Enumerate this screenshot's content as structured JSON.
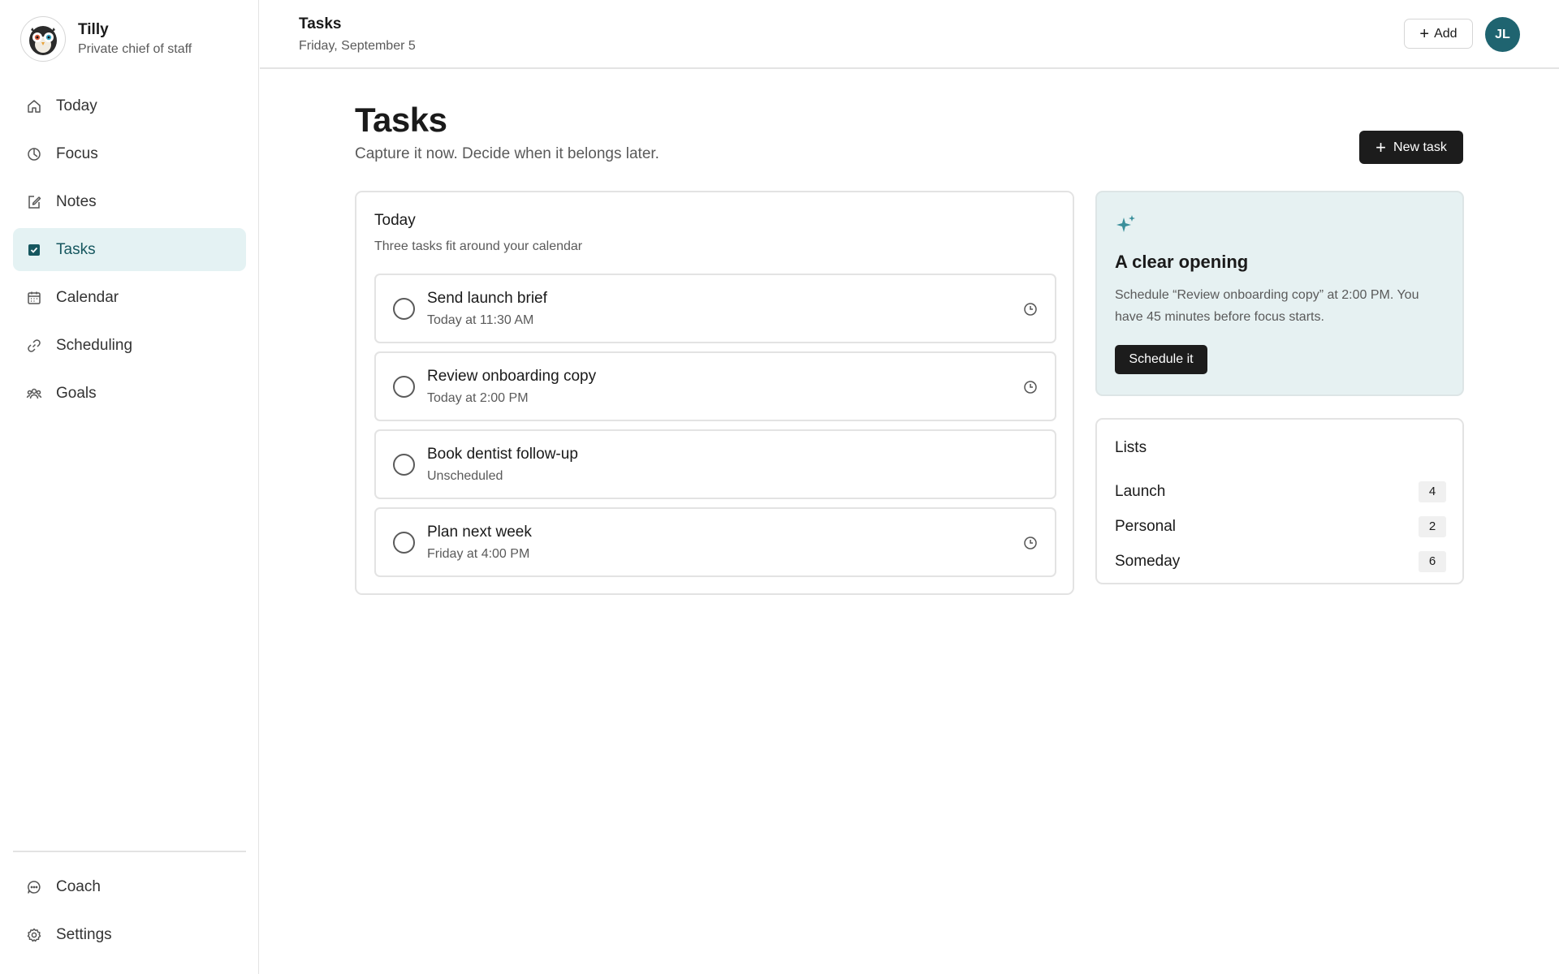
{
  "app": {
    "name": "Tilly",
    "tagline": "Private chief of staff"
  },
  "sidebar": {
    "items": [
      {
        "label": "Today",
        "icon": "home-icon"
      },
      {
        "label": "Focus",
        "icon": "focus-icon"
      },
      {
        "label": "Notes",
        "icon": "note-edit-icon"
      },
      {
        "label": "Tasks",
        "icon": "checkbox-icon",
        "active": true
      },
      {
        "label": "Calendar",
        "icon": "calendar-icon"
      },
      {
        "label": "Scheduling",
        "icon": "link-icon"
      },
      {
        "label": "Goals",
        "icon": "people-icon"
      }
    ],
    "bottom_items": [
      {
        "label": "Coach",
        "icon": "chat-icon"
      },
      {
        "label": "Settings",
        "icon": "gear-icon"
      }
    ]
  },
  "header": {
    "title": "Tasks",
    "date": "Friday, September 5",
    "add_label": "Add",
    "avatar_initials": "JL"
  },
  "main": {
    "title": "Tasks",
    "subtitle": "Capture it now. Decide when it belongs later.",
    "new_task_label": "New task"
  },
  "today_card": {
    "title": "Today",
    "subtitle": "Three tasks fit around your calendar",
    "tasks": [
      {
        "title": "Send launch brief",
        "time": "Today at 11:30 AM",
        "has_clock": true
      },
      {
        "title": "Review onboarding copy",
        "time": "Today at 2:00 PM",
        "has_clock": true
      },
      {
        "title": "Book dentist follow-up",
        "time": "Unscheduled",
        "has_clock": false
      },
      {
        "title": "Plan next week",
        "time": "Friday at 4:00 PM",
        "has_clock": true
      }
    ]
  },
  "opening_card": {
    "title": "A clear opening",
    "body": "Schedule “Review onboarding copy” at 2:00 PM. You have 45 minutes before focus starts.",
    "button_label": "Schedule it"
  },
  "lists_card": {
    "title": "Lists",
    "lists": [
      {
        "name": "Launch",
        "count": "4"
      },
      {
        "name": "Personal",
        "count": "2"
      },
      {
        "name": "Someday",
        "count": "6"
      }
    ]
  },
  "colors": {
    "accent": "#1f6470",
    "active_nav_bg": "#e4f2f3",
    "opening_card_bg": "#e6f1f2",
    "primary_button": "#1c1c1c"
  }
}
